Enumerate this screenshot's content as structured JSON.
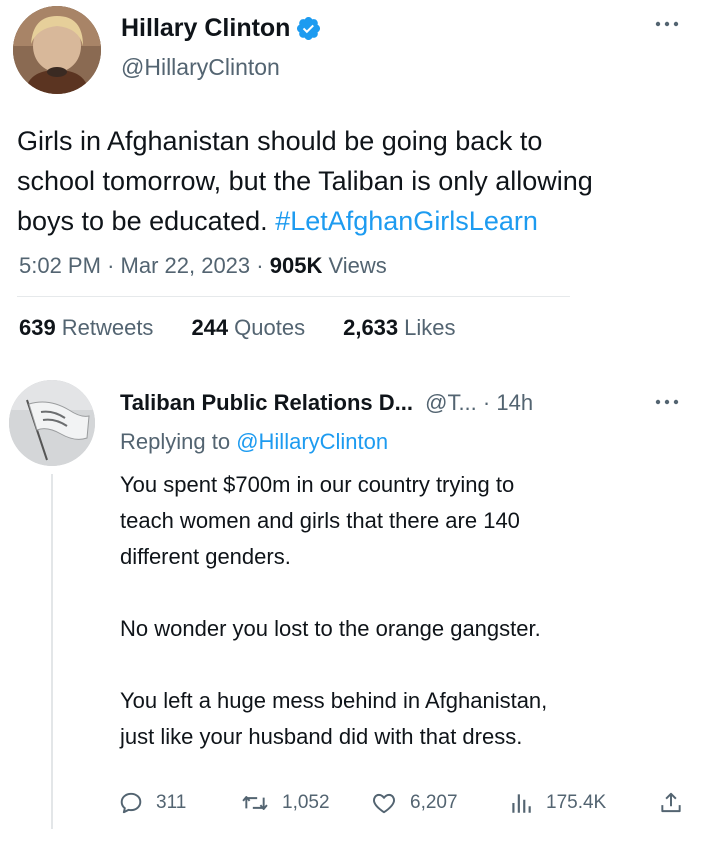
{
  "main_tweet": {
    "author_name": "Hillary Clinton",
    "author_handle": "@HillaryClinton",
    "text_lines": [
      "Girls in Afghanistan should be going back to",
      "school tomorrow, but the Taliban is only allowing",
      "boys to be educated. "
    ],
    "hashtag": "#LetAfghanGirlsLearn",
    "time": "5:02 PM",
    "date": "Mar 22, 2023",
    "views_count": "905K",
    "views_label": "Views",
    "stats": {
      "retweets_count": "639",
      "retweets_label": "Retweets",
      "quotes_count": "244",
      "quotes_label": "Quotes",
      "likes_count": "2,633",
      "likes_label": "Likes"
    }
  },
  "reply": {
    "author_name": "Taliban Public Relations D...",
    "author_handle": "@T...",
    "separator": "·",
    "age": "14h",
    "replying_label": "Replying to",
    "replying_mention": "@HillaryClinton",
    "paragraph_1": [
      "You spent $700m in our country trying to",
      "teach women and girls that there are 140",
      "different genders."
    ],
    "paragraph_2": [
      "No wonder you lost to the orange gangster."
    ],
    "paragraph_3": [
      "You left a huge mess behind in Afghanistan,",
      "just like your husband did with that dress."
    ],
    "actions": {
      "replies": "311",
      "retweets": "1,052",
      "likes": "6,207",
      "views": "175.4K"
    }
  },
  "colors": {
    "accent": "#1d9bf0",
    "secondary_text": "#536471",
    "primary_text": "#0f1419",
    "divider": "#e6e9eb"
  },
  "icons": {
    "verified": "verified-badge-icon",
    "more": "more-horizontal-icon",
    "reply": "reply-bubble-icon",
    "retweet": "retweet-icon",
    "like": "heart-icon",
    "views": "views-bar-chart-icon",
    "share": "share-upload-icon"
  }
}
